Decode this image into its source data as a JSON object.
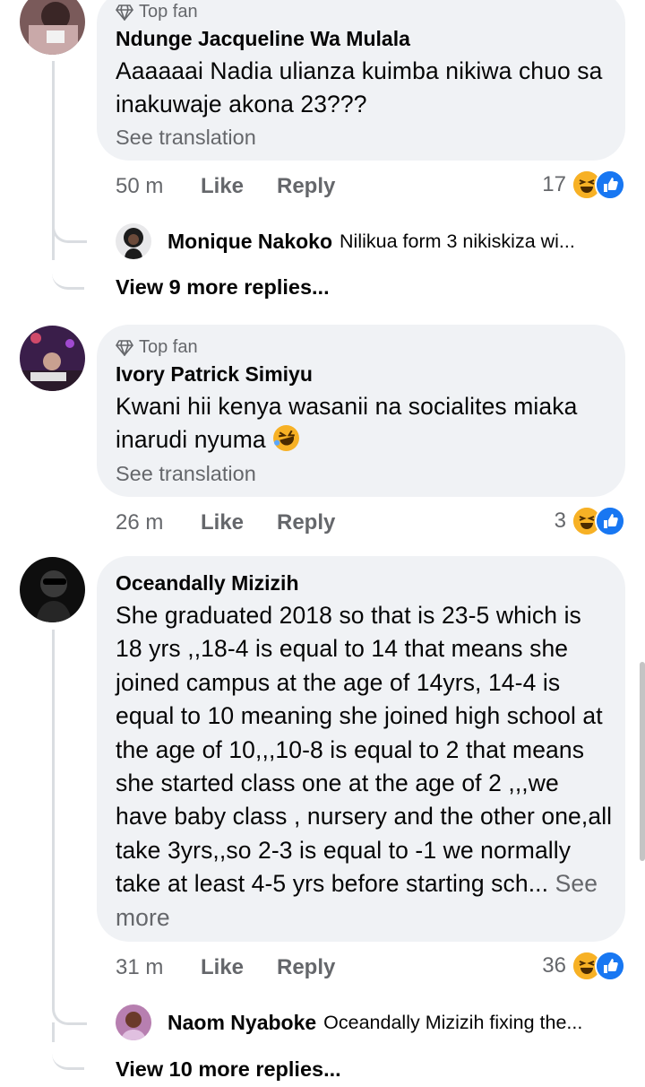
{
  "comments": [
    {
      "badge": "Top fan",
      "author": "Ndunge Jacqueline Wa Mulala",
      "text": "Aaaaaai Nadia ulianza kuimba nikiwa chuo sa inakuwaje akona 23???",
      "see_translation": "See translation",
      "time": "50 m",
      "like": "Like",
      "reply": "Reply",
      "reaction_count": "17",
      "reply_preview": {
        "author": "Monique Nakoko",
        "text": "Nilikua form 3 nikiskiza wi..."
      },
      "view_more": "View 9 more replies..."
    },
    {
      "badge": "Top fan",
      "author": "Ivory Patrick Simiyu",
      "text": "Kwani hii kenya wasanii na socialites miaka inarudi nyuma",
      "emoji": "🤣",
      "see_translation": "See translation",
      "time": "26 m",
      "like": "Like",
      "reply": "Reply",
      "reaction_count": "3"
    },
    {
      "author": "Oceandally Mizizih",
      "text": "She graduated 2018 so that is 23-5 which is 18 yrs ,,18-4 is equal to 14 that means she joined campus at the age of 14yrs, 14-4 is equal to 10 meaning she joined high school at the age of 10,,,10-8 is equal to 2 that means she started class one at the age of 2 ,,,we have baby class , nursery and the other one,all take 3yrs,,so 2-3 is equal to -1 we normally take at least 4-5 yrs before starting sch...",
      "see_more": "See more",
      "time": "31 m",
      "like": "Like",
      "reply": "Reply",
      "reaction_count": "36",
      "reply_preview": {
        "author": "Naom Nyaboke",
        "text": "Oceandally Mizizih fixing the..."
      },
      "view_more": "View 10 more replies..."
    }
  ],
  "colors": {
    "bubble": "#f0f2f5",
    "secondary_text": "#65676b",
    "like_blue": "#1877f2",
    "haha_yellow": "#f7b125",
    "thread_line": "#dadde1"
  }
}
